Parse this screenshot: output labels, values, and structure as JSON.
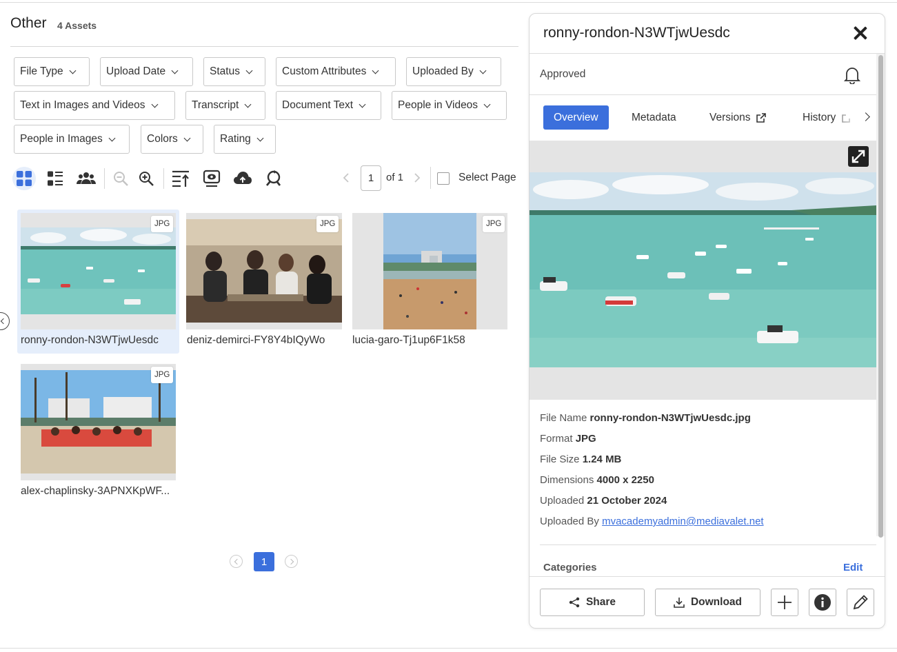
{
  "header": {
    "title": "Other",
    "asset_count": "4 Assets"
  },
  "filters": [
    "File Type",
    "Upload Date",
    "Status",
    "Custom Attributes",
    "Uploaded By",
    "Text in Images and Videos",
    "Transcript",
    "Document Text",
    "People in Videos",
    "People in Images",
    "Colors",
    "Rating"
  ],
  "toolbar": {
    "icons": [
      "grid-view-icon",
      "list-view-icon",
      "people-icon",
      "zoom-out-icon",
      "zoom-in-icon",
      "sort-icon",
      "preview-icon",
      "upload-icon",
      "rotate-search-icon"
    ]
  },
  "pagination": {
    "current": "1",
    "of_label": "of 1",
    "select_page_label": "Select Page"
  },
  "assets": [
    {
      "name": "ronny-rondon-N3WTjwUesdc",
      "format": "JPG"
    },
    {
      "name": "deniz-demirci-FY8Y4bIQyWo",
      "format": "JPG"
    },
    {
      "name": "lucia-garo-Tj1up6F1k58",
      "format": "JPG"
    },
    {
      "name": "alex-chaplinsky-3APNXKpWF...",
      "format": "JPG"
    }
  ],
  "bottom_pagination": {
    "current": "1"
  },
  "detail": {
    "title": "ronny-rondon-N3WTjwUesdc",
    "status": "Approved",
    "tabs": [
      "Overview",
      "Metadata",
      "Versions",
      "History"
    ],
    "meta": {
      "file_name_label": "File Name",
      "file_name": "ronny-rondon-N3WTjwUesdc.jpg",
      "format_label": "Format",
      "format": "JPG",
      "file_size_label": "File Size",
      "file_size": "1.24 MB",
      "dimensions_label": "Dimensions",
      "dimensions": "4000 x 2250",
      "uploaded_label": "Uploaded",
      "uploaded": "21 October 2024",
      "uploaded_by_label": "Uploaded By",
      "uploaded_by": "mvacademyadmin@mediavalet.net"
    },
    "categories_label": "Categories",
    "categories_edit": "Edit",
    "actions": {
      "share": "Share",
      "download": "Download"
    }
  },
  "colors": {
    "accent": "#3b6fdc",
    "selected_card": "#e5eefb",
    "sea": "#5fb8b3"
  }
}
